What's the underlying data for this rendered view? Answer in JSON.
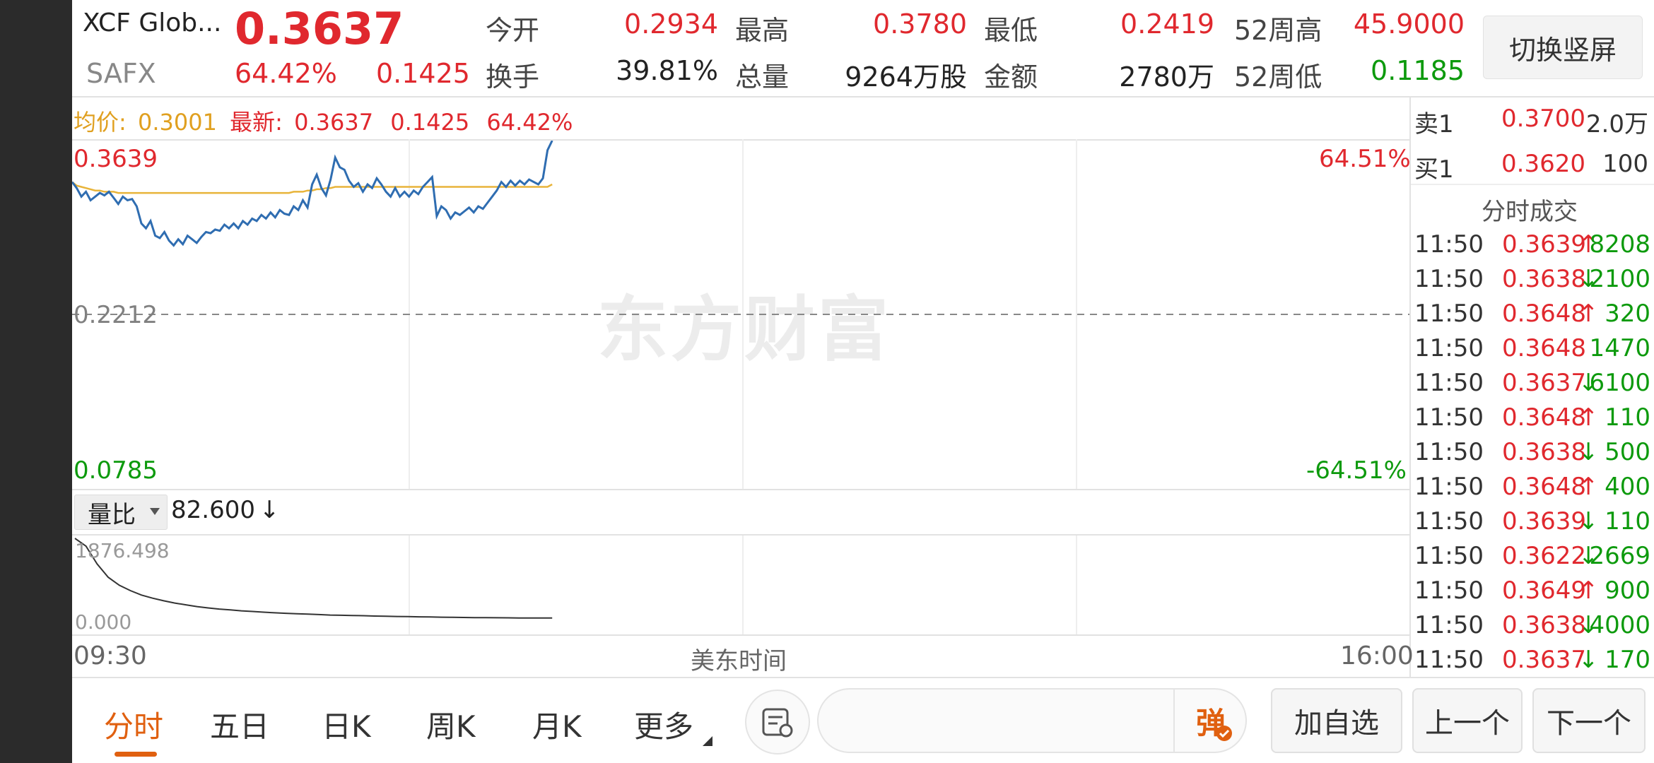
{
  "header": {
    "name": "XCF Glob...",
    "price": "0.3637",
    "code": "SAFX",
    "change_pct": "64.42%",
    "change": "0.1425",
    "stats": [
      {
        "label": "今开",
        "value": "0.2934",
        "color": "#e0282e"
      },
      {
        "label": "最高",
        "value": "0.3780",
        "color": "#e0282e"
      },
      {
        "label": "最低",
        "value": "0.2419",
        "color": "#e0282e"
      },
      {
        "label": "52周高",
        "value": "45.9000",
        "color": "#e0282e"
      },
      {
        "label": "换手",
        "value": "39.81%",
        "color": "#222222"
      },
      {
        "label": "总量",
        "value": "9264万股",
        "color": "#222222"
      },
      {
        "label": "金额",
        "value": "2780万",
        "color": "#222222"
      },
      {
        "label": "52周低",
        "value": "0.1185",
        "color": "#0d9a0d"
      }
    ],
    "switch_label": "切换竖屏"
  },
  "chart": {
    "avg_label": "均价:",
    "avg_value": "0.3001",
    "latest_label": "最新:",
    "latest_price": "0.3637",
    "latest_change": "0.1425",
    "latest_pct": "64.42%",
    "top_price": "0.3639",
    "top_pct": "64.51%",
    "mid_price": "0.2212",
    "bottom_price": "0.0785",
    "bottom_pct": "-64.51%",
    "watermark": "东方财富",
    "volume_ratio_label": "量比",
    "volume_ratio_value": "82.600",
    "volume_ratio_arrow": "↓",
    "vol_top": "1876.498",
    "vol_bottom": "0.000",
    "time_start": "09:30",
    "time_mid": "美东时间",
    "time_end": "16:00"
  },
  "order_book": {
    "ask": {
      "label": "卖1",
      "price": "0.3700",
      "volume": "2.0万"
    },
    "bid": {
      "label": "买1",
      "price": "0.3620",
      "volume": "100"
    },
    "ticks_title": "分时成交"
  },
  "ticks": [
    {
      "time": "11:50",
      "price": "0.3639",
      "dir": "↑",
      "vol": "8208"
    },
    {
      "time": "11:50",
      "price": "0.3638",
      "dir": "↓",
      "vol": "2100"
    },
    {
      "time": "11:50",
      "price": "0.3648",
      "dir": "↑",
      "vol": "320"
    },
    {
      "time": "11:50",
      "price": "0.3648",
      "dir": "",
      "vol": "1470"
    },
    {
      "time": "11:50",
      "price": "0.3637",
      "dir": "↓",
      "vol": "6100"
    },
    {
      "time": "11:50",
      "price": "0.3648",
      "dir": "↑",
      "vol": "110"
    },
    {
      "time": "11:50",
      "price": "0.3638",
      "dir": "↓",
      "vol": "500"
    },
    {
      "time": "11:50",
      "price": "0.3648",
      "dir": "↑",
      "vol": "400"
    },
    {
      "time": "11:50",
      "price": "0.3639",
      "dir": "↓",
      "vol": "110"
    },
    {
      "time": "11:50",
      "price": "0.3622",
      "dir": "↓",
      "vol": "2669"
    },
    {
      "time": "11:50",
      "price": "0.3649",
      "dir": "↑",
      "vol": "900"
    },
    {
      "time": "11:50",
      "price": "0.3638",
      "dir": "↓",
      "vol": "4000"
    },
    {
      "time": "11:50",
      "price": "0.3637",
      "dir": "↓",
      "vol": "170"
    }
  ],
  "tabs": [
    "分时",
    "五日",
    "日K",
    "周K",
    "月K",
    "更多"
  ],
  "bottom": {
    "danmu_label": "弹",
    "add_watch": "加自选",
    "prev": "上一个",
    "next": "下一个"
  },
  "colors": {
    "up": "#e0282e",
    "down": "#0d9a0d",
    "accent": "#e06010",
    "price_line": "#2f6db1",
    "avg_line": "#e8b43a"
  },
  "price_series": [
    0.33,
    0.325,
    0.318,
    0.322,
    0.315,
    0.318,
    0.321,
    0.319,
    0.322,
    0.317,
    0.312,
    0.318,
    0.315,
    0.316,
    0.31,
    0.296,
    0.292,
    0.298,
    0.286,
    0.284,
    0.289,
    0.282,
    0.278,
    0.283,
    0.279,
    0.286,
    0.283,
    0.28,
    0.285,
    0.289,
    0.288,
    0.291,
    0.29,
    0.295,
    0.292,
    0.296,
    0.292,
    0.298,
    0.295,
    0.3,
    0.298,
    0.303,
    0.3,
    0.305,
    0.301,
    0.307,
    0.304,
    0.303,
    0.31,
    0.307,
    0.315,
    0.309,
    0.328,
    0.336,
    0.325,
    0.319,
    0.332,
    0.35,
    0.342,
    0.34,
    0.331,
    0.326,
    0.329,
    0.322,
    0.328,
    0.325,
    0.333,
    0.328,
    0.322,
    0.318,
    0.325,
    0.318,
    0.322,
    0.318,
    0.323,
    0.32,
    0.326,
    0.33,
    0.334,
    0.302,
    0.31,
    0.307,
    0.3,
    0.305,
    0.303,
    0.306,
    0.309,
    0.305,
    0.31,
    0.308,
    0.313,
    0.318,
    0.323,
    0.33,
    0.326,
    0.331,
    0.327,
    0.331,
    0.328,
    0.332,
    0.33,
    0.328,
    0.333,
    0.356,
    0.3639
  ],
  "avg_series": [
    0.33,
    0.327,
    0.326,
    0.325,
    0.324,
    0.323,
    0.323,
    0.322,
    0.322,
    0.322,
    0.321,
    0.321,
    0.321,
    0.321,
    0.321,
    0.321,
    0.321,
    0.321,
    0.321,
    0.321,
    0.321,
    0.321,
    0.321,
    0.321,
    0.321,
    0.321,
    0.321,
    0.321,
    0.321,
    0.321,
    0.321,
    0.321,
    0.321,
    0.321,
    0.321,
    0.321,
    0.321,
    0.321,
    0.321,
    0.321,
    0.321,
    0.321,
    0.321,
    0.321,
    0.321,
    0.321,
    0.321,
    0.321,
    0.322,
    0.322,
    0.322,
    0.323,
    0.323,
    0.324,
    0.324,
    0.325,
    0.325,
    0.326,
    0.326,
    0.326,
    0.326,
    0.326,
    0.326,
    0.326,
    0.326,
    0.326,
    0.326,
    0.326,
    0.326,
    0.326,
    0.326,
    0.326,
    0.326,
    0.326,
    0.326,
    0.326,
    0.326,
    0.326,
    0.326,
    0.326,
    0.326,
    0.326,
    0.326,
    0.326,
    0.326,
    0.326,
    0.326,
    0.326,
    0.326,
    0.326,
    0.326,
    0.326,
    0.326,
    0.326,
    0.326,
    0.326,
    0.326,
    0.326,
    0.326,
    0.326,
    0.326,
    0.326,
    0.326,
    0.326,
    0.328
  ],
  "vol_ratio_series": [
    1876.498,
    1700,
    1300,
    1000,
    820,
    700,
    600,
    530,
    470,
    420,
    380,
    340,
    310,
    285,
    265,
    245,
    230,
    215,
    200,
    190,
    180,
    170,
    160,
    150,
    145,
    140,
    135,
    128,
    122,
    118,
    114,
    110,
    106,
    102,
    99,
    96,
    93,
    91,
    89,
    87,
    85,
    84,
    83,
    82.6
  ]
}
